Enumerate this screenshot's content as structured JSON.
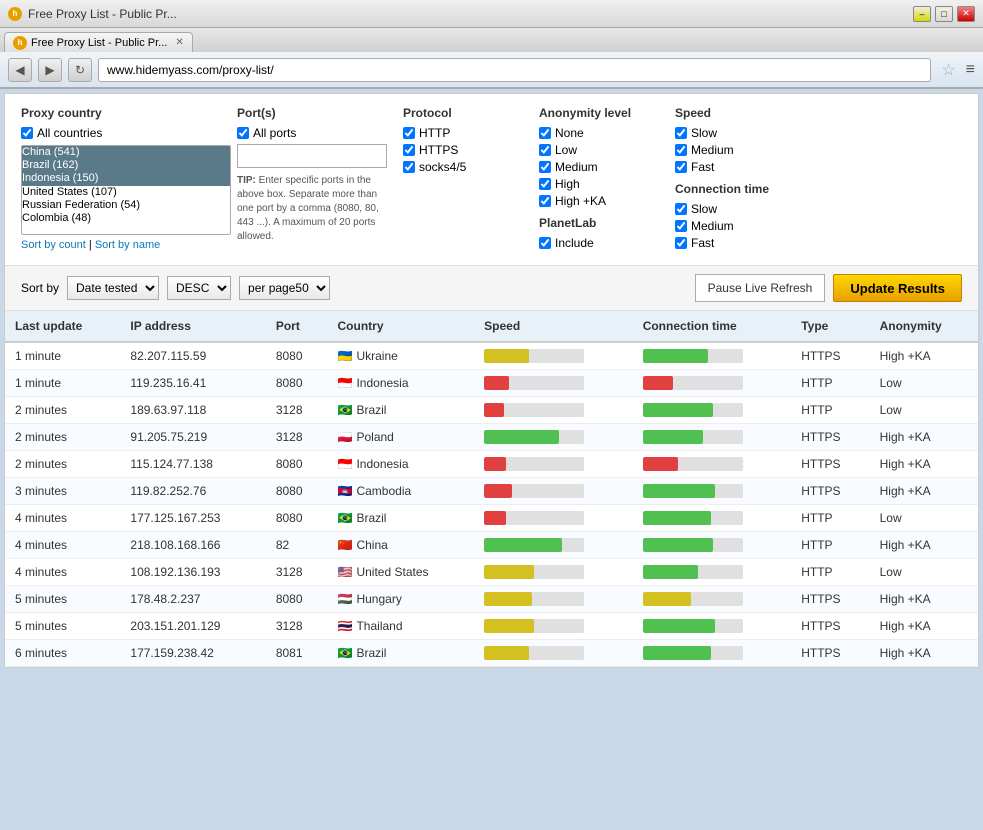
{
  "browser": {
    "title": "Free Proxy List - Public Pr...",
    "tab_label": "Free Proxy List - Public Pr...",
    "address": "www.hidemyass.com/proxy-list/",
    "back_btn": "◀",
    "forward_btn": "▶",
    "reload_btn": "↻"
  },
  "filters": {
    "proxy_country_title": "Proxy country",
    "all_countries_label": "All countries",
    "countries": [
      "China (541)",
      "Brazil (162)",
      "Indonesia (150)",
      "United States (107)",
      "Russian Federation (54)",
      "Colombia (48)"
    ],
    "sort_by_count": "Sort by count",
    "sort_by_name": "Sort by name",
    "ports_title": "Port(s)",
    "all_ports_label": "All ports",
    "port_placeholder": "",
    "port_tip": "TIP: Enter specific ports in the above box. Separate more than one port by a comma (8080, 80, 443 ...). A maximum of 20 ports allowed.",
    "protocol_title": "Protocol",
    "protocol_options": [
      "HTTP",
      "HTTPS",
      "socks4/5"
    ],
    "anonymity_title": "Anonymity level",
    "anonymity_options": [
      "None",
      "Low",
      "Medium",
      "High",
      "High +KA"
    ],
    "planetlab_title": "PlanetLab",
    "planetlab_options": [
      "Include"
    ],
    "speed_title": "Speed",
    "speed_options": [
      "Slow",
      "Medium",
      "Fast"
    ],
    "connection_time_title": "Connection time",
    "connection_time_options": [
      "Slow",
      "Medium",
      "Fast"
    ]
  },
  "sort_controls": {
    "sort_by_label": "Sort by",
    "sort_field": "Date tested",
    "sort_order": "DESC",
    "per_page": "per page50",
    "pause_btn_label": "Pause Live Refresh",
    "update_btn_label": "Update Results"
  },
  "table": {
    "headers": [
      "Last update",
      "IP address",
      "Port",
      "Country",
      "Speed",
      "Connection time",
      "Type",
      "Anonymity"
    ],
    "rows": [
      {
        "last_update": "1 minute",
        "ip": "82.207.115.59",
        "port": "8080",
        "country": "Ukraine",
        "flag": "🇺🇦",
        "speed_pct": 45,
        "speed_color": "yellow",
        "conn_pct": 65,
        "conn_color": "green",
        "type": "HTTPS",
        "anonymity": "High +KA"
      },
      {
        "last_update": "1 minute",
        "ip": "119.235.16.41",
        "port": "8080",
        "country": "Indonesia",
        "flag": "🇮🇩",
        "speed_pct": 25,
        "speed_color": "red",
        "conn_pct": 30,
        "conn_color": "red",
        "type": "HTTP",
        "anonymity": "Low"
      },
      {
        "last_update": "2 minutes",
        "ip": "189.63.97.118",
        "port": "3128",
        "country": "Brazil",
        "flag": "🇧🇷",
        "speed_pct": 20,
        "speed_color": "red",
        "conn_pct": 70,
        "conn_color": "green",
        "type": "HTTP",
        "anonymity": "Low"
      },
      {
        "last_update": "2 minutes",
        "ip": "91.205.75.219",
        "port": "3128",
        "country": "Poland",
        "flag": "🇵🇱",
        "speed_pct": 75,
        "speed_color": "green",
        "conn_pct": 60,
        "conn_color": "green",
        "type": "HTTPS",
        "anonymity": "High +KA"
      },
      {
        "last_update": "2 minutes",
        "ip": "115.124.77.138",
        "port": "8080",
        "country": "Indonesia",
        "flag": "🇮🇩",
        "speed_pct": 22,
        "speed_color": "red",
        "conn_pct": 35,
        "conn_color": "red",
        "type": "HTTPS",
        "anonymity": "High +KA"
      },
      {
        "last_update": "3 minutes",
        "ip": "119.82.252.76",
        "port": "8080",
        "country": "Cambodia",
        "flag": "🇰🇭",
        "speed_pct": 28,
        "speed_color": "red",
        "conn_pct": 72,
        "conn_color": "green",
        "type": "HTTPS",
        "anonymity": "High +KA"
      },
      {
        "last_update": "4 minutes",
        "ip": "177.125.167.253",
        "port": "8080",
        "country": "Brazil",
        "flag": "🇧🇷",
        "speed_pct": 22,
        "speed_color": "red",
        "conn_pct": 68,
        "conn_color": "green",
        "type": "HTTP",
        "anonymity": "Low"
      },
      {
        "last_update": "4 minutes",
        "ip": "218.108.168.166",
        "port": "82",
        "country": "China",
        "flag": "🇨🇳",
        "speed_pct": 78,
        "speed_color": "green",
        "conn_pct": 70,
        "conn_color": "green",
        "type": "HTTP",
        "anonymity": "High +KA"
      },
      {
        "last_update": "4 minutes",
        "ip": "108.192.136.193",
        "port": "3128",
        "country": "United States",
        "flag": "🇺🇸",
        "speed_pct": 50,
        "speed_color": "yellow",
        "conn_pct": 55,
        "conn_color": "green",
        "type": "HTTP",
        "anonymity": "Low"
      },
      {
        "last_update": "5 minutes",
        "ip": "178.48.2.237",
        "port": "8080",
        "country": "Hungary",
        "flag": "🇭🇺",
        "speed_pct": 48,
        "speed_color": "yellow",
        "conn_pct": 48,
        "conn_color": "yellow",
        "type": "HTTPS",
        "anonymity": "High +KA"
      },
      {
        "last_update": "5 minutes",
        "ip": "203.151.201.129",
        "port": "3128",
        "country": "Thailand",
        "flag": "🇹🇭",
        "speed_pct": 50,
        "speed_color": "yellow",
        "conn_pct": 72,
        "conn_color": "green",
        "type": "HTTPS",
        "anonymity": "High +KA"
      },
      {
        "last_update": "6 minutes",
        "ip": "177.159.238.42",
        "port": "8081",
        "country": "Brazil",
        "flag": "🇧🇷",
        "speed_pct": 45,
        "speed_color": "yellow",
        "conn_pct": 68,
        "conn_color": "green",
        "type": "HTTPS",
        "anonymity": "High +KA"
      }
    ]
  }
}
